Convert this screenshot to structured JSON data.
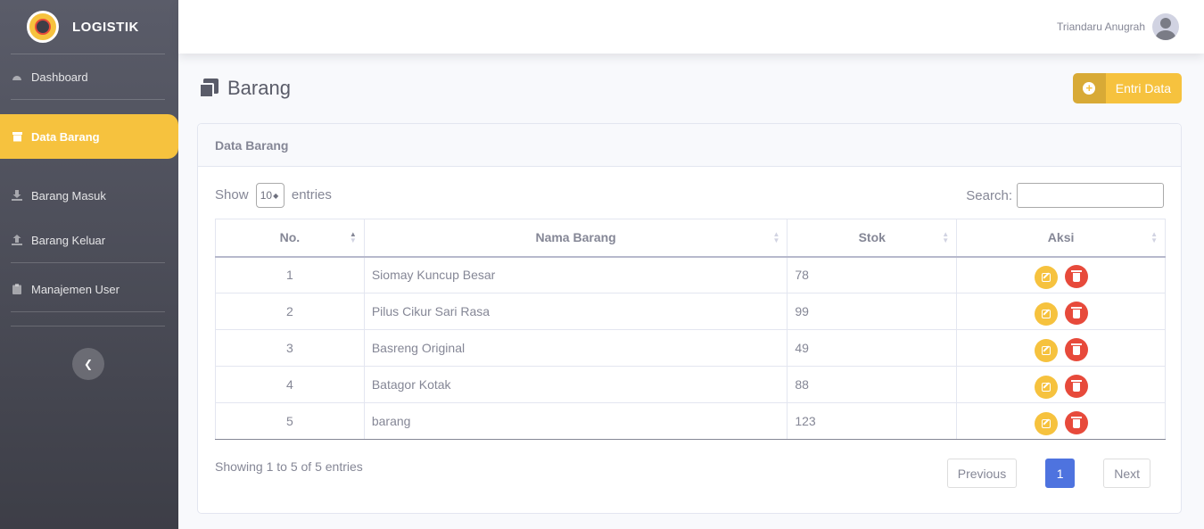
{
  "brand": {
    "name": "LOGISTIK"
  },
  "sidebar": {
    "items": [
      {
        "label": "Dashboard",
        "icon": "dashboard-icon"
      },
      {
        "label": "Data Barang",
        "icon": "box-icon",
        "active": true
      },
      {
        "label": "Barang Masuk",
        "icon": "download-icon"
      },
      {
        "label": "Barang Keluar",
        "icon": "upload-icon"
      },
      {
        "label": "Manajemen User",
        "icon": "clipboard-icon"
      }
    ],
    "collapse_icon": "chevron-left-icon"
  },
  "topbar": {
    "username": "Triandaru Anugrah"
  },
  "page": {
    "title": "Barang",
    "entri_label": "Entri Data"
  },
  "card": {
    "title": "Data Barang",
    "show_label": "Show",
    "show_value": "10",
    "entries_label": "entries",
    "search_label": "Search:",
    "search_value": ""
  },
  "table": {
    "headers": [
      "No.",
      "Nama Barang",
      "Stok",
      "Aksi"
    ],
    "rows": [
      {
        "no": "1",
        "nama": "Siomay Kuncup Besar",
        "stok": "78"
      },
      {
        "no": "2",
        "nama": "Pilus Cikur Sari Rasa",
        "stok": "99"
      },
      {
        "no": "3",
        "nama": "Basreng Original",
        "stok": "49"
      },
      {
        "no": "4",
        "nama": "Batagor Kotak",
        "stok": "88"
      },
      {
        "no": "5",
        "nama": "barang",
        "stok": "123"
      }
    ]
  },
  "footer": {
    "info": "Showing 1 to 5 of 5 entries",
    "previous": "Previous",
    "page": "1",
    "next": "Next"
  },
  "colors": {
    "accent": "#f6c23e",
    "danger": "#e74a3b",
    "primary": "#4e73df",
    "sidebar": "#5a5c69"
  }
}
